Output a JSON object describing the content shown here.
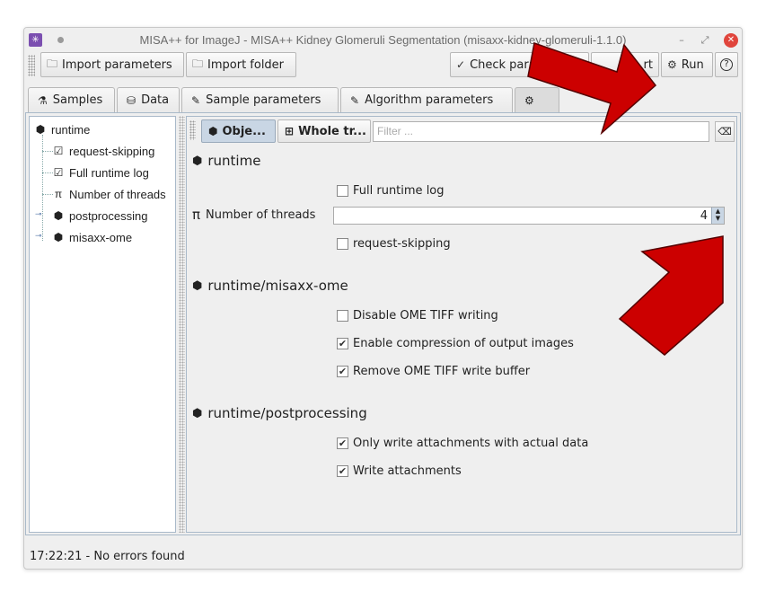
{
  "window": {
    "title": "MISA++ for ImageJ - MISA++ Kidney Glomeruli Segmentation (misaxx-kidney-glomeruli-1.1.0)",
    "min_glyph": "–",
    "max_glyph": "⤢",
    "close_glyph": "✕"
  },
  "toolbar": {
    "import_parameters": "Import parameters",
    "import_folder": "Import folder",
    "check_parameters": "Check parameters",
    "export_partial": "rt",
    "run": "Run",
    "help_glyph": "?"
  },
  "tabs": [
    {
      "label": "Samples"
    },
    {
      "label": "Data"
    },
    {
      "label": "Sample parameters"
    },
    {
      "label": "Algorithm parameters"
    }
  ],
  "tree": {
    "items": [
      {
        "label": "runtime"
      },
      {
        "label": "request-skipping"
      },
      {
        "label": "Full runtime log"
      },
      {
        "label": "Number of threads"
      },
      {
        "label": "postprocessing"
      },
      {
        "label": "misaxx-ome"
      }
    ]
  },
  "subbar": {
    "objects_label": "Obje...",
    "whole_tree_label": "Whole tr...",
    "filter_placeholder": "Filter ..."
  },
  "sections": {
    "runtime": {
      "title": "runtime",
      "full_runtime_log": {
        "label": "Full runtime log",
        "checked": false
      },
      "number_of_threads": {
        "label": "Number of threads",
        "value": "4"
      },
      "request_skipping": {
        "label": "request-skipping",
        "checked": false
      }
    },
    "misaxx_ome": {
      "title": "runtime/misaxx-ome",
      "disable_ome_tiff": {
        "label": "Disable OME TIFF writing",
        "checked": false
      },
      "enable_compression": {
        "label": "Enable compression of output images",
        "checked": true
      },
      "remove_write_buffer": {
        "label": "Remove OME TIFF write buffer",
        "checked": true
      }
    },
    "postprocessing": {
      "title": "runtime/postprocessing",
      "only_write_attachments": {
        "label": "Only write attachments with actual data",
        "checked": true
      },
      "write_attachments": {
        "label": "Write attachments",
        "checked": true
      }
    }
  },
  "status": {
    "text": "17:22:21 - No errors found"
  },
  "colors": {
    "arrow": "#cc0000",
    "accent_selected": "#c9d6e4",
    "close_button": "#e0453c"
  },
  "icons": {
    "cube": "cube-icon",
    "check": "checkbox-icon",
    "pi": "pi-icon",
    "flask": "flask-icon",
    "database": "database-icon",
    "pencil": "pencil-icon",
    "gear": "gear-icon",
    "play": "run-icon",
    "folder": "folder-icon"
  }
}
